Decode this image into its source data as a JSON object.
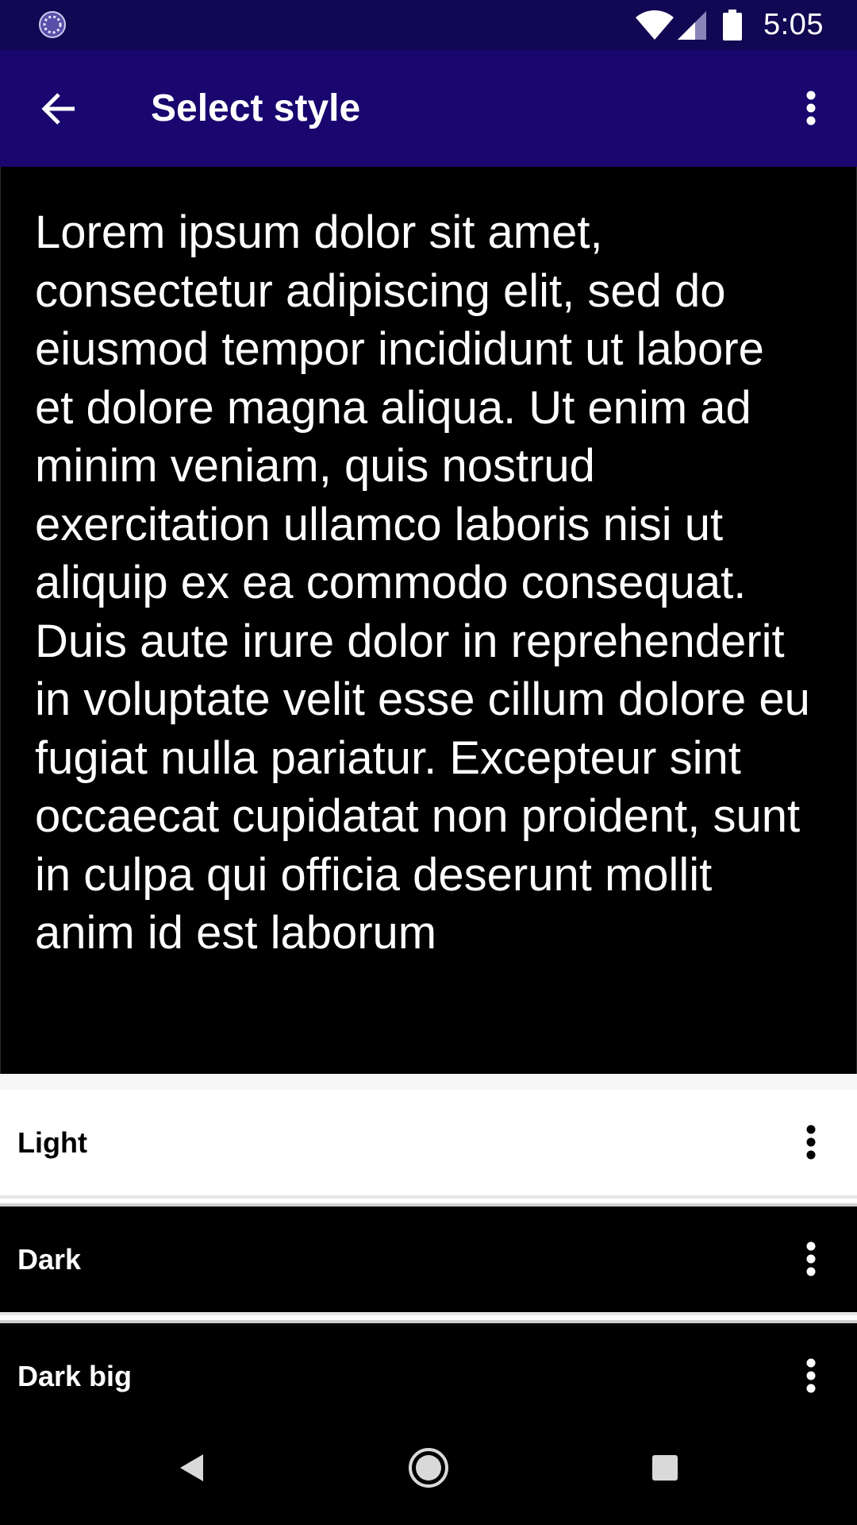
{
  "status_bar": {
    "time": "5:05",
    "icons": [
      "loading-spinner-icon",
      "wifi-icon",
      "cell-signal-icon",
      "battery-icon"
    ]
  },
  "app_bar": {
    "title": "Select style",
    "back_icon": "arrow-back-icon",
    "menu_icon": "more-vert-icon"
  },
  "preview": {
    "text": "Lorem ipsum dolor sit amet, consectetur adipiscing elit, sed do eiusmod tempor incididunt ut labore et dolore magna aliqua. Ut enim ad minim veniam, quis nostrud exercitation ullamco laboris nisi ut aliquip ex ea commodo consequat. Duis aute irure dolor in reprehenderit in voluptate velit esse cillum dolore eu fugiat nulla pariatur. Excepteur sint occaecat cupidatat non proident, sunt in culpa qui officia deserunt mollit anim id est laborum"
  },
  "styles": [
    {
      "label": "Light",
      "theme": "light"
    },
    {
      "label": "Dark",
      "theme": "dark"
    },
    {
      "label": "Dark big",
      "theme": "dark"
    }
  ],
  "nav_bar": {
    "icons": [
      "nav-back-icon",
      "nav-home-icon",
      "nav-recents-icon"
    ]
  },
  "colors": {
    "status_bar": "#110752",
    "app_bar": "#1a066f",
    "preview_background": "#000000",
    "preview_text": "#ffffff"
  }
}
